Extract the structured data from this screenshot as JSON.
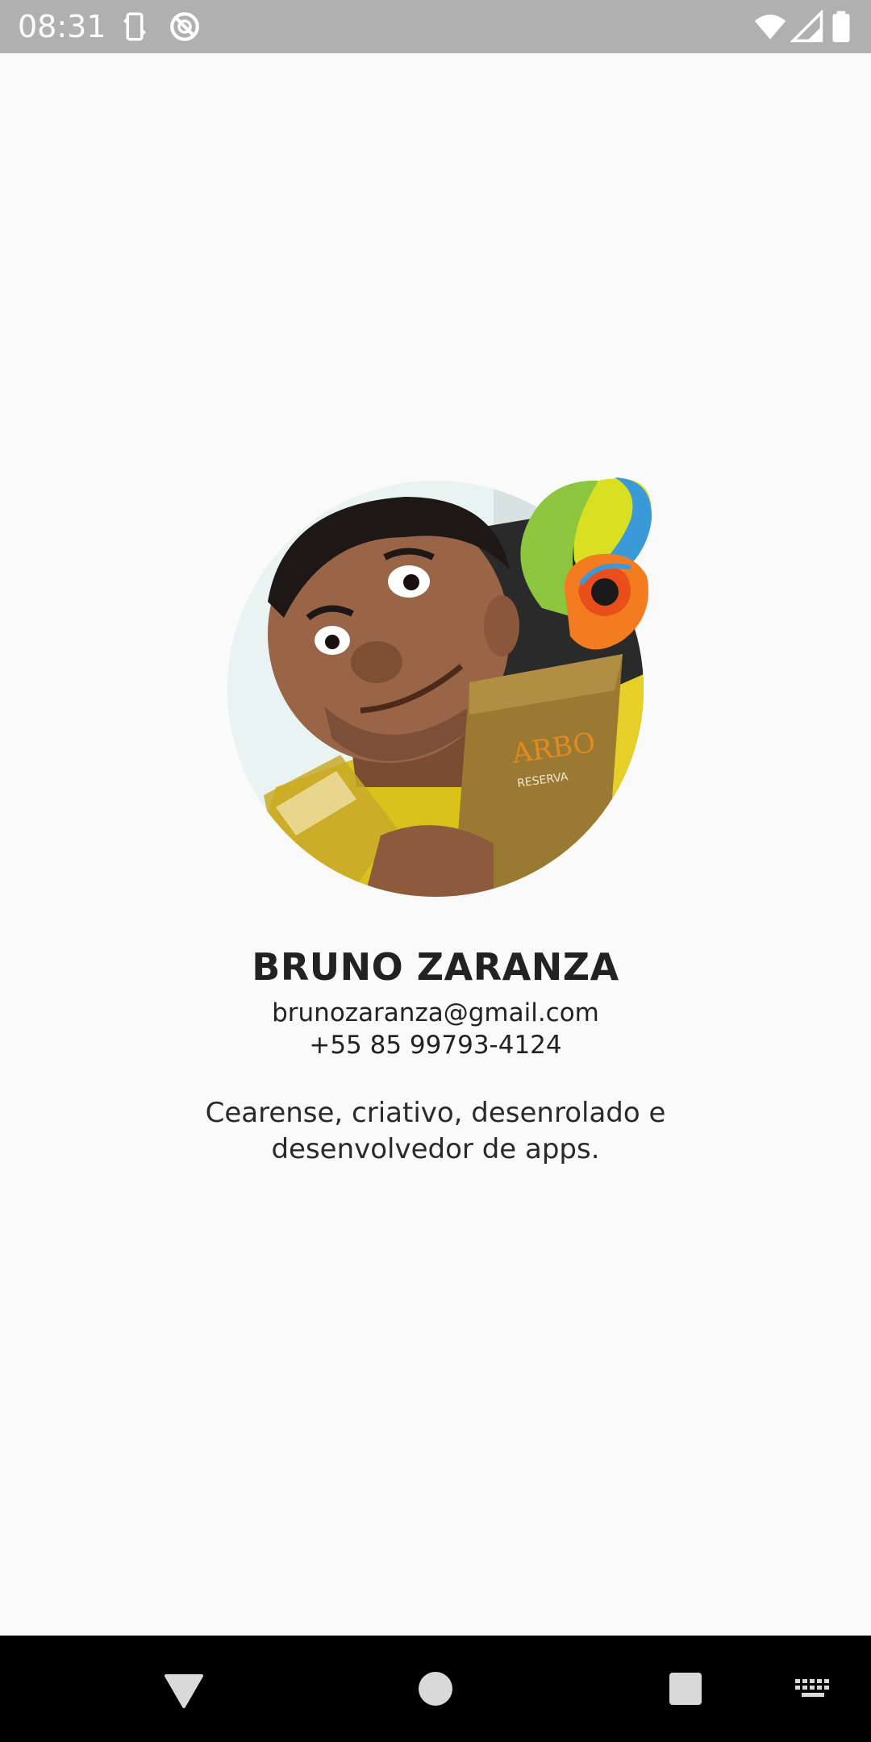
{
  "status_bar": {
    "time": "08:31",
    "icons": [
      "screen-rotate-icon",
      "sync-off-icon",
      "wifi-icon",
      "signal-icon",
      "battery-icon"
    ]
  },
  "profile": {
    "name": "BRUNO ZARANZA",
    "email": "brunozaranza@gmail.com",
    "phone": "+55 85 99793-4124",
    "bio": "Cearense, criativo, desenrolado e desenvolvedor de apps.",
    "avatar_icon": "profile-photo",
    "badge_icon": "logo-badge-icon"
  },
  "navigation": {
    "buttons": [
      "back-icon",
      "home-icon",
      "recents-icon",
      "keyboard-icon"
    ]
  },
  "colors": {
    "background": "#fafafa",
    "status_bar": "#b0b0b0",
    "nav_bar": "#000000",
    "text": "#222222"
  }
}
